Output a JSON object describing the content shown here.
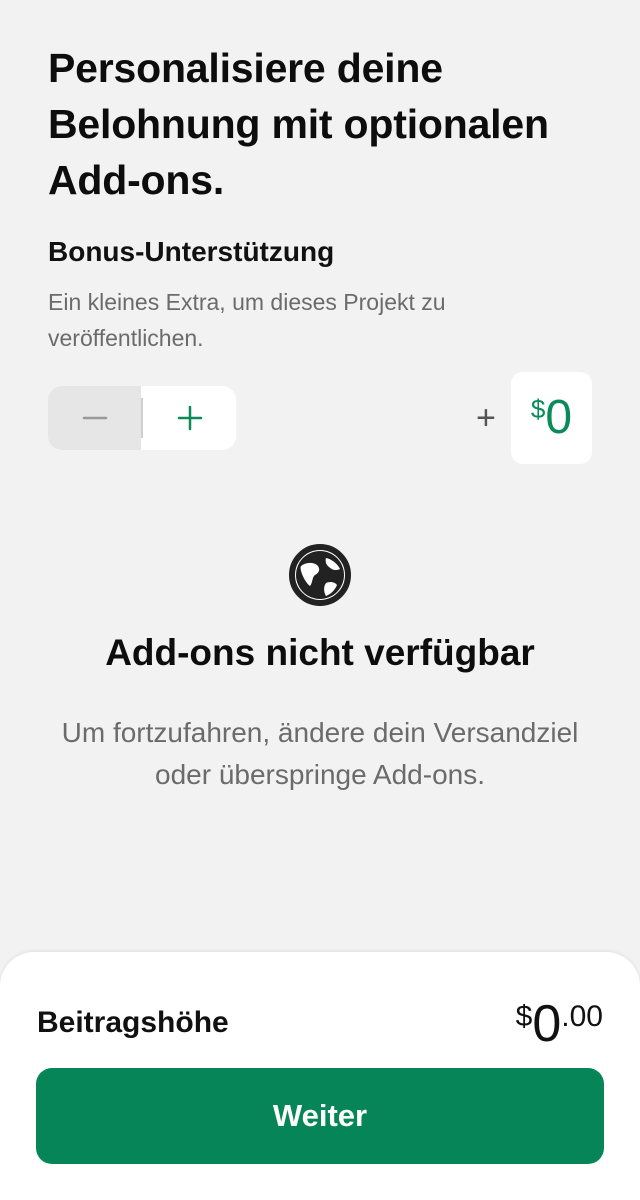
{
  "header": {
    "title": "Personalisiere deine Belohnung mit optionalen Add-ons."
  },
  "bonus": {
    "title": "Bonus-Unterstützung",
    "description": "Ein kleines Extra, um dieses Projekt zu veröffentlichen.",
    "plus_sign": "+",
    "currency_symbol": "$",
    "amount": "0",
    "minus_icon": "minus-icon",
    "plus_icon": "plus-icon"
  },
  "empty_state": {
    "icon": "globe-icon",
    "title": "Add-ons nicht verfügbar",
    "description": "Um fortzufahren, ändere dein Versandziel oder überspringe Add-ons."
  },
  "footer": {
    "total_label": "Beitragshöhe",
    "currency_symbol": "$",
    "total_whole": "0",
    "total_cents": ".00",
    "button_label": "Weiter"
  },
  "colors": {
    "accent": "#058558",
    "accent_text": "#0b8a5a",
    "background": "#f2f2f2",
    "muted_text": "#6b6b6b"
  }
}
